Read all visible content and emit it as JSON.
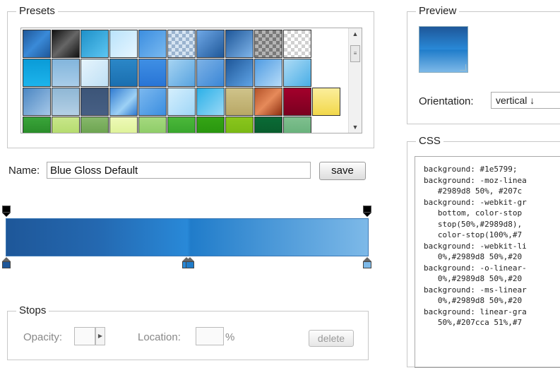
{
  "presets": {
    "legend": "Presets",
    "swatches": [
      "linear-gradient(135deg,#1e5799,#3a8ad8 50%,#1e5799)",
      "linear-gradient(135deg,#111,#666 50%,#111)",
      "linear-gradient(135deg,#1e90c8,#5dc6f2)",
      "linear-gradient(135deg,#b9e3fb,#e8f6ff)",
      "linear-gradient(135deg,#3c8ee0,#79b9f0)",
      "repeating-conic-gradient(#9ab3cf 0 25%,#d6e4f2 0 50%) 0 0/10px 10px",
      "linear-gradient(135deg,#6fa8e6,#1e5799)",
      "linear-gradient(135deg,#1e5799,#80b5ea)",
      "repeating-conic-gradient(#7a7a7a 0 25%,#b5b5b5 0 50%) 0 0/10px 10px",
      "repeating-conic-gradient(#d0d0d0 0 25%,#fff 0 50%) 0 0/10px 10px",
      "#ffffff",
      "linear-gradient(#0a9bd7,#1db4ec)",
      "linear-gradient(#82b5dc,#a9cde9)",
      "linear-gradient(135deg,#e6f4fc,#bfe0f5)",
      "linear-gradient(#2b87c7,#1b6fb0)",
      "linear-gradient(#3f8fe4,#2975d6)",
      "linear-gradient(135deg,#a7d4f2,#57a3e0)",
      "linear-gradient(135deg,#7db2e6,#3a86d6)",
      "linear-gradient(135deg,#1e5799,#60a4e6)",
      "linear-gradient(135deg,#4f9be2,#b7dcf8)",
      "linear-gradient(135deg,#aedbf5,#49aee6)",
      "#ffffff",
      "linear-gradient(135deg,#4b86c2,#a6c8e8)",
      "linear-gradient(#8fb7d5,#b4d0e5)",
      "linear-gradient(#3c5578,#475f84)",
      "linear-gradient(135deg,#2f7ad0,#9dd1f5 60%,#2f7ad0)",
      "linear-gradient(135deg,#7bb8ef,#3b8ee0)",
      "linear-gradient(135deg,#d5effd,#9fd6f7)",
      "linear-gradient(135deg,#2bb0e8,#9ad9f6)",
      "linear-gradient(#cfc38a,#b9a866)",
      "linear-gradient(135deg,#b4532a,#e68a5a 50%,#8e2f10)",
      "linear-gradient(#a3002b,#7a0020)",
      "linear-gradient(#fbee9c,#f2d84a)",
      "linear-gradient(#3aa53a,#1f7c1f)",
      "linear-gradient(#c8e68a,#a8d45c)",
      "linear-gradient(#86b86a,#5c9640)",
      "linear-gradient(#eef9b8,#d4ee86)",
      "linear-gradient(#a4d97e,#80c459)",
      "linear-gradient(#4bb83a,#2c9a24)",
      "linear-gradient(#35a515,#218c0b)",
      "linear-gradient(#8ac61d,#6fb00e)",
      "linear-gradient(#0b6b36,#075427)",
      "linear-gradient(#7fc08f,#5aa86f)",
      "#ffffff"
    ]
  },
  "name": {
    "label": "Name:",
    "value": "Blue Gloss Default",
    "save_label": "save"
  },
  "gradient": {
    "opacity_stops": [
      0,
      100
    ],
    "color_stops": [
      {
        "location": 0,
        "color": "#1e5799"
      },
      {
        "location": 50,
        "color": "#2989d8"
      },
      {
        "location": 51,
        "color": "#207cca"
      },
      {
        "location": 100,
        "color": "#7db9e8"
      }
    ]
  },
  "stops": {
    "legend": "Stops",
    "opacity_label": "Opacity:",
    "location_label": "Location:",
    "location_unit": "%",
    "delete_label": "delete"
  },
  "preview": {
    "legend": "Preview",
    "orientation_label": "Orientation:",
    "orientation_value": "vertical  ↓"
  },
  "css": {
    "legend": "CSS",
    "code": "background: #1e5799;\nbackground: -moz-linea\n   #2989d8 50%, #207c\nbackground: -webkit-gr\n   bottom, color-stop\n   stop(50%,#2989d8),\n   color-stop(100%,#7\nbackground: -webkit-li\n   0%,#2989d8 50%,#20\nbackground: -o-linear-\n   0%,#2989d8 50%,#20\nbackground: -ms-linear\n   0%,#2989d8 50%,#20\nbackground: linear-gra\n   50%,#207cca 51%,#7"
  }
}
